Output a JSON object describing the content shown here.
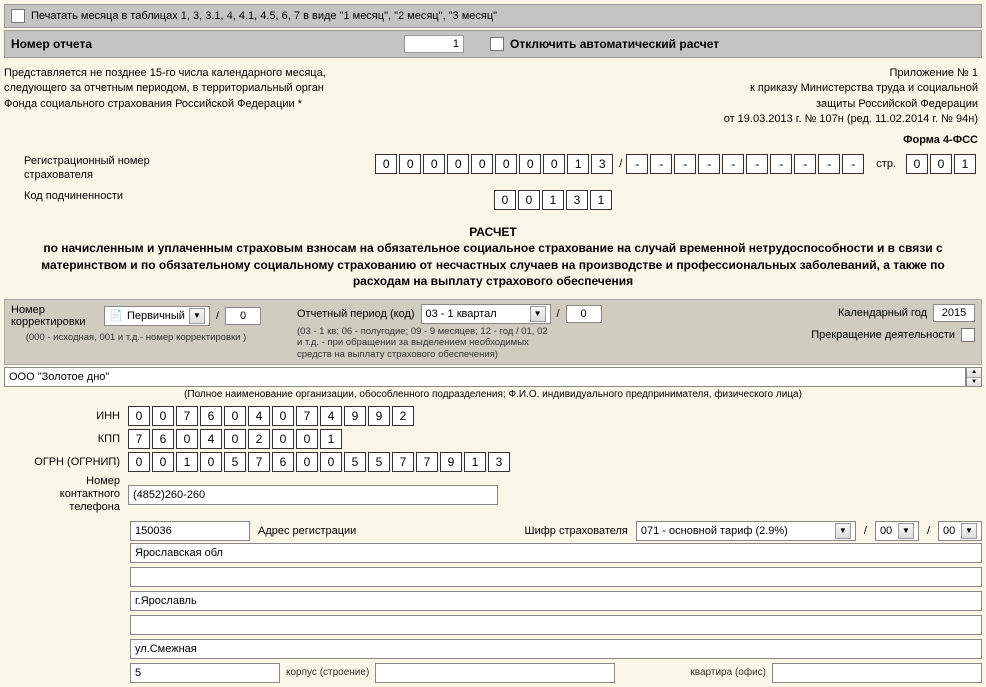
{
  "top1": {
    "text": "Печатать месяца в таблицах 1, 3, 3.1, 4, 4.1, 4.5, 6, 7 в виде \"1 месяц\", \"2 месяц\", \"3 месяц\""
  },
  "top2": {
    "label": "Номер отчета",
    "value": "1",
    "disable_label": "Отключить автоматический расчет"
  },
  "right_header": {
    "l1": "Приложение № 1",
    "l2": "к приказу Министерства труда и социальной",
    "l3": "защиты Российской Федерации",
    "l4": "от 19.03.2013 г. № 107н (ред. 11.02.2014 г. № 94н)"
  },
  "left_header": {
    "l1": "Представляется не позднее 15-го числа календарного месяца,",
    "l2": "следующего за отчетным периодом, в территориальный орган",
    "l3": "Фонда социального страхования Российской Федерации *"
  },
  "form_label": "Форма 4-ФСС",
  "reg_label": "Регистрационный номер страхователя",
  "reg": [
    "0",
    "0",
    "0",
    "0",
    "0",
    "0",
    "0",
    "0",
    "1",
    "3"
  ],
  "reg_ext": [
    "-",
    "-",
    "-",
    "-",
    "-",
    "-",
    "-",
    "-",
    "-",
    "-"
  ],
  "page_label": "стр.",
  "page": [
    "0",
    "0",
    "1"
  ],
  "sub_label": "Код подчиненности",
  "sub": [
    "0",
    "0",
    "1",
    "3",
    "1"
  ],
  "title": {
    "h": "РАСЧЕТ",
    "t": "по начисленным и уплаченным страховым взносам на обязательное социальное страхование на случай временной нетрудоспособности и в связи с материнством и по обязательному социальному страхованию от несчастных случаев на производстве и профессиональных заболеваний, а также по расходам на выплату страхового обеспечения"
  },
  "corr": {
    "label": "Номер корректировки",
    "dd": "Первичный",
    "num": "0",
    "hint": "(000 - исходная, 001 и т.д.- номер корректировки )"
  },
  "period": {
    "label": "Отчетный период (код)",
    "dd": "03 - 1 квартал",
    "num": "0",
    "hint1": "(03 - 1 кв; 06 - полугодие; 09 - 9 месяцев; 12 - год / 01, 02",
    "hint2": "и т.д. - при обращении за выделением необходимых",
    "hint3": "средств на выплату страхового обеспечения)"
  },
  "year": {
    "label": "Календарный год",
    "value": "2015"
  },
  "cease": {
    "label": "Прекращение деятельности"
  },
  "org_name": "ООО \"Золотое дно\"",
  "org_caption": "(Полное наименование организации, обособленного подразделения; Ф.И.О. индивидуального предпринимателя, физического лица)",
  "inn_label": "ИНН",
  "inn": [
    "0",
    "0",
    "7",
    "6",
    "0",
    "4",
    "0",
    "7",
    "4",
    "9",
    "9",
    "2"
  ],
  "kpp_label": "КПП",
  "kpp": [
    "7",
    "6",
    "0",
    "4",
    "0",
    "2",
    "0",
    "0",
    "1"
  ],
  "ogrn_label": "ОГРН (ОГРНИП)",
  "ogrn": [
    "0",
    "0",
    "1",
    "0",
    "5",
    "7",
    "6",
    "0",
    "0",
    "5",
    "5",
    "7",
    "7",
    "9",
    "1",
    "3"
  ],
  "phone_label": "Номер контактного телефона",
  "phone": "(4852)260-260",
  "postcode": "150036",
  "addr_label": "Адрес регистрации",
  "tariff_label": "Шифр страхователя",
  "tariff": "071 - основной тариф (2.9%)",
  "tariff2": "00",
  "tariff3": "00",
  "region": "Ярославская обл",
  "city": "г.Ярославль",
  "street": "ул.Смежная",
  "house": "5",
  "korpus_label": "корпус (строение)",
  "flat_label": "квартира (офис)"
}
